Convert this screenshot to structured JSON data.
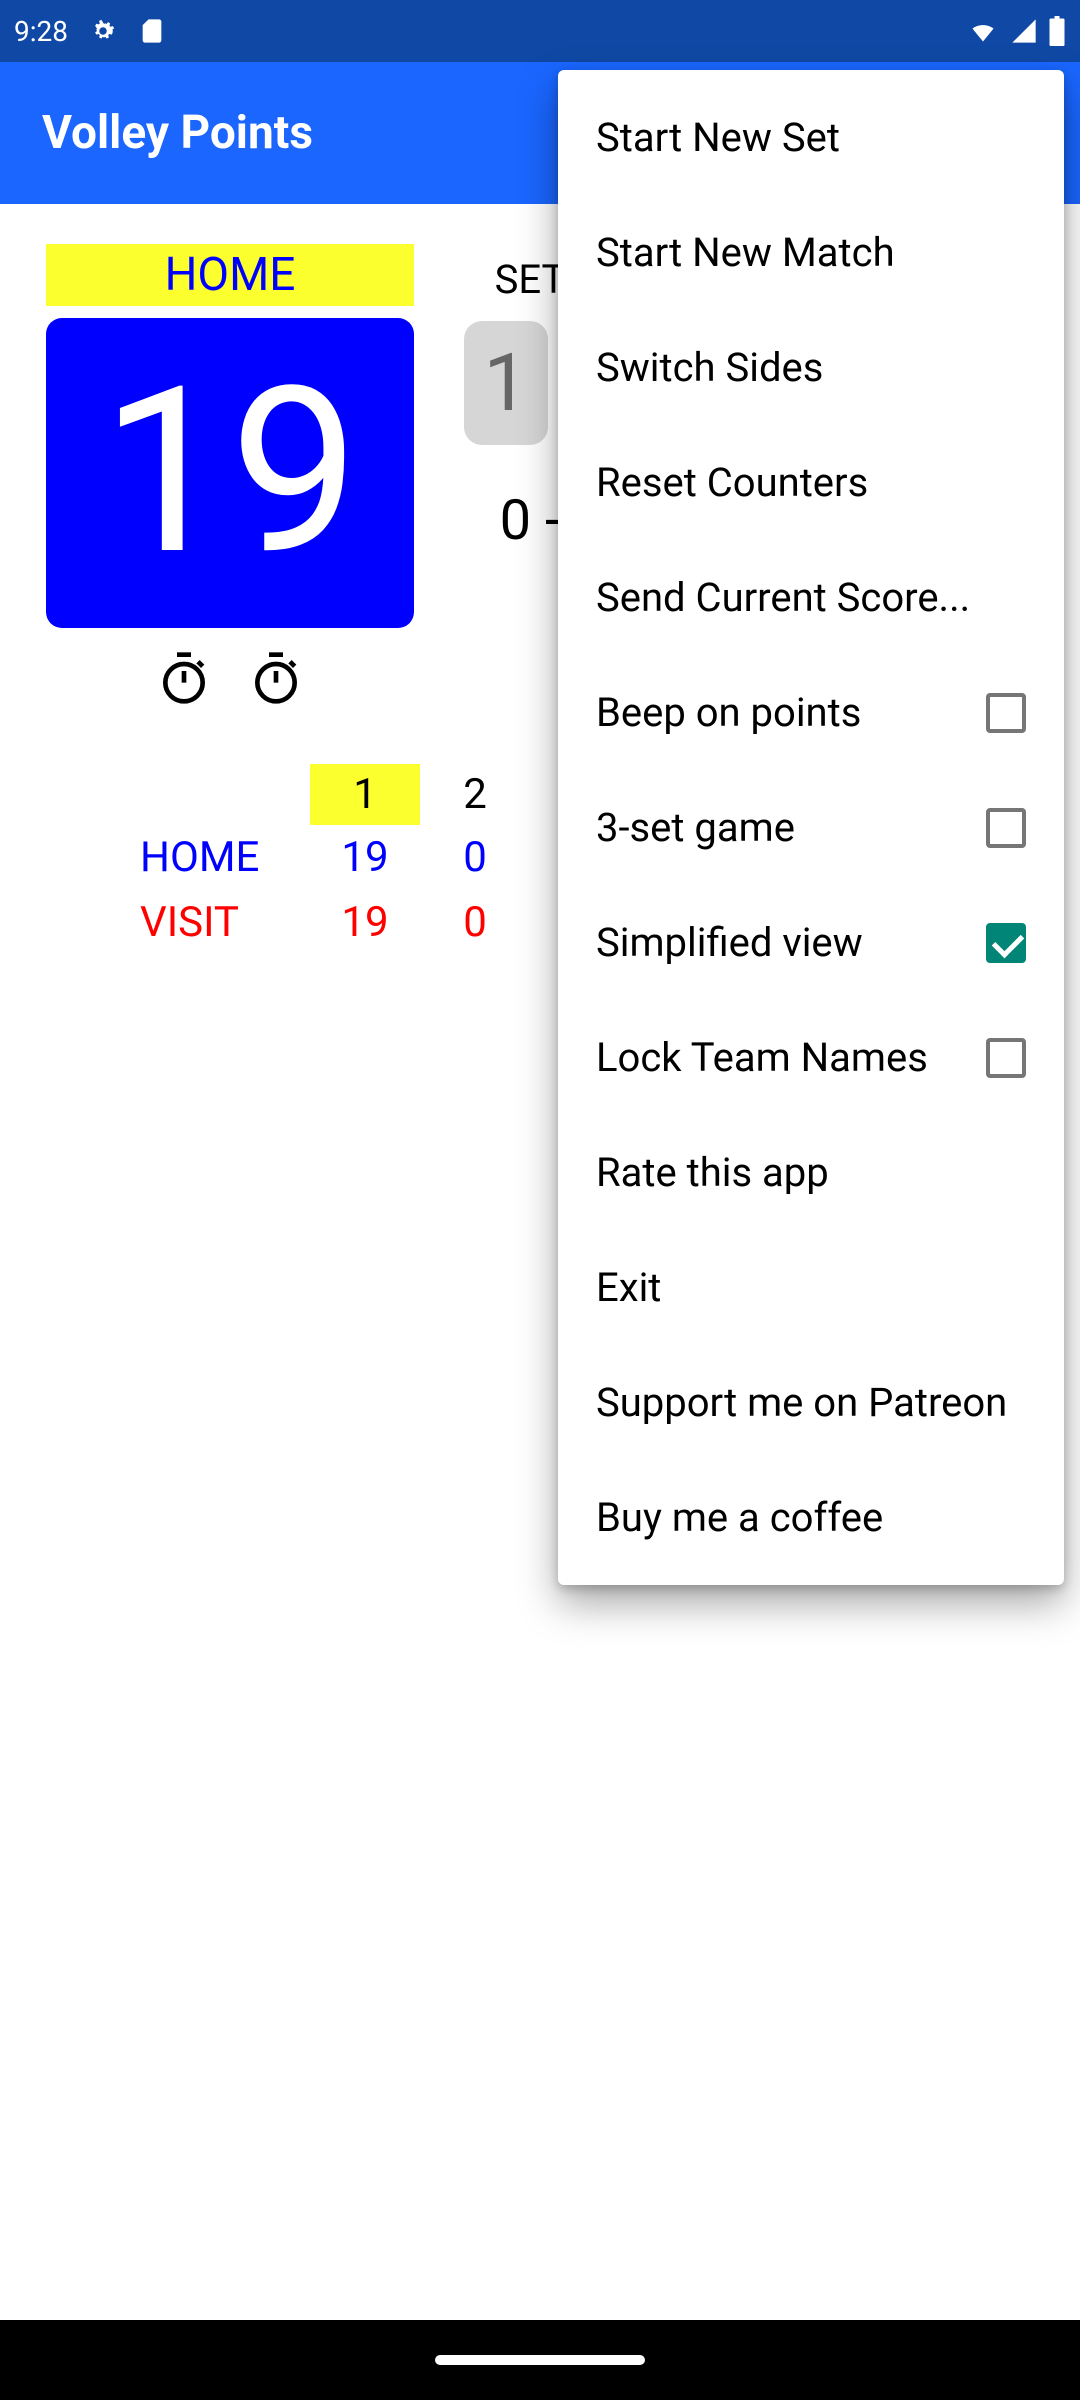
{
  "status": {
    "time": "9:28"
  },
  "app": {
    "title": "Volley Points"
  },
  "score": {
    "home_label": "HOME",
    "home_points": "19",
    "set_label": "SET",
    "set_box": "1",
    "set_diff": "0 -"
  },
  "table": {
    "cols": {
      "c1": "1",
      "c2": "2"
    },
    "home": {
      "name": "HOME",
      "c1": "19",
      "c2": "0"
    },
    "visit": {
      "name": "VISIT",
      "c1": "19",
      "c2": "0"
    }
  },
  "menu": {
    "start_new_set": "Start New Set",
    "start_new_match": "Start New Match",
    "switch_sides": "Switch Sides",
    "reset_counters": "Reset Counters",
    "send_score": "Send Current Score...",
    "beep": "Beep on points",
    "three_set": "3-set game",
    "simplified": "Simplified view",
    "lock_names": "Lock Team Names",
    "rate": "Rate this app",
    "exit": "Exit",
    "patreon": "Support me on Patreon",
    "coffee": "Buy me a coffee"
  }
}
